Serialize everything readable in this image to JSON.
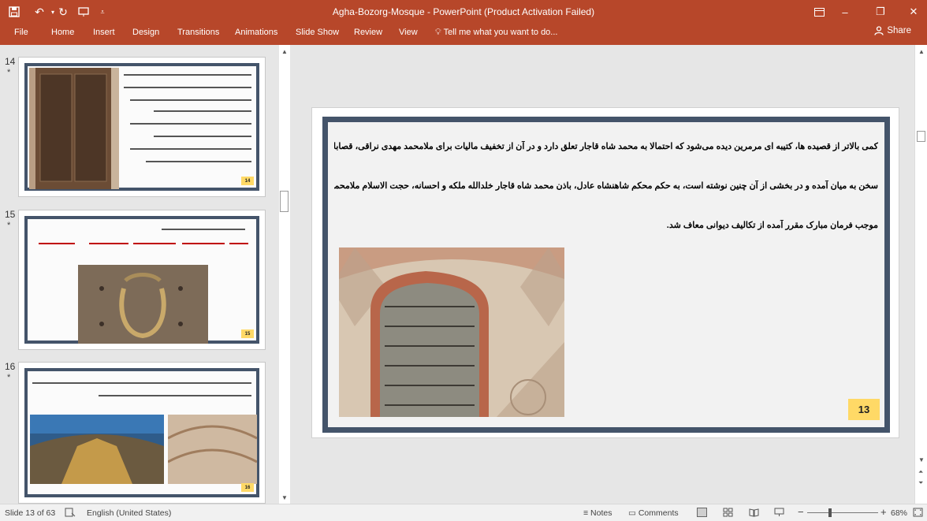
{
  "window": {
    "title": "Agha-Bozorg-Mosque - PowerPoint (Product Activation Failed)",
    "minimize": "–",
    "restore": "❐",
    "close": "✕"
  },
  "ribbon": {
    "tabs": [
      "File",
      "Home",
      "Insert",
      "Design",
      "Transitions",
      "Animations",
      "Slide Show",
      "Review",
      "View"
    ],
    "tell_me": "Tell me what you want to do...",
    "share": "Share"
  },
  "thumbnails": [
    {
      "number": "14",
      "star": "*",
      "badge": "14"
    },
    {
      "number": "15",
      "star": "*",
      "badge": "15"
    },
    {
      "number": "16",
      "star": "*",
      "badge": "16"
    }
  ],
  "slide": {
    "paragraph_lines": [
      "کمی بالاتر از قصیده ها، کتیبه ای مرمرین دیده می‌شود که احتمالا به محمد شاه قاجار تعلق دارد و در آن از تخفیف مالیات برای ملامحمد مهدی نراقی، قصابان و دباغان",
      "سخن به میان آمده و در بخشی از آن چنین نوشته است، به حکم محکم شاهنشاه عادل، باذن محمد شاه قاجار خلدالله ملکه و احسانه، حجت الاسلام ملامحمد مهدی نراقی به",
      "موجب فرمان مبارک مقرر آمده از تکالیف دیوانی معاف شد."
    ],
    "page_number": "13"
  },
  "status": {
    "slide_info": "Slide 13 of 63",
    "language": "English (United States)",
    "notes": "Notes",
    "comments": "Comments",
    "zoom": "68%",
    "zoom_level": 0.68
  },
  "colors": {
    "accent": "#b7472a",
    "frame": "#44546a",
    "badge": "#ffd966"
  }
}
